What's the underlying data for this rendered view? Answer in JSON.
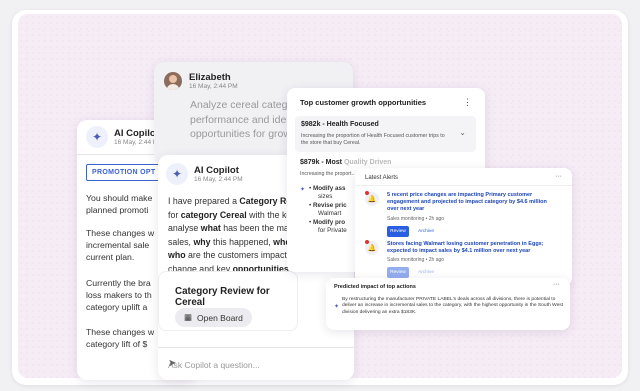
{
  "left_chat": {
    "name": "AI Copilot",
    "time": "16 May, 2:44 P",
    "promo_tag": "PROMOTION OPT",
    "paragraphs": [
      "You should make",
      "planned promoti",
      "These changes w",
      "incremental sale",
      "current plan.",
      "Currently the bra",
      "loss makers to th",
      "category uplift a",
      "These changes w",
      "category lift of $"
    ]
  },
  "elizabeth": {
    "name": "Elizabeth",
    "time": "16 May, 2:44 PM",
    "message_lines": [
      "Analyze cereal categor",
      "performance and identi",
      "opportunities for growt"
    ]
  },
  "copilot": {
    "name": "AI Copilot",
    "time": "16 May, 2:44 PM",
    "body": {
      "t1": "I have prepared a ",
      "b1": "Category Revi",
      "t2": "for ",
      "b2": "category Cereal",
      "t3": " with the key",
      "t4": "analyse ",
      "b3": "what",
      "t5": " has been the main",
      "t6": "sales, ",
      "b4": "why",
      "t7": " this happened, ",
      "b5": "where",
      "b6": "who",
      "t8": " are the customers impacting",
      "t9": "change and key ",
      "b7": "opportunities"
    },
    "review_title": "Category Review for Cereal",
    "open_board": "Open Board",
    "ask_placeholder": "Ask Copilot a question..."
  },
  "growth": {
    "title": "Top customer growth opportunities",
    "row1_title": "$982k - Health Focused",
    "row1_desc": "Increasing the proportion of Health Focused customer trips to the store that buy Cereal.",
    "row2_title_a": "$879k - Most ",
    "row2_title_b": "Quality Driven",
    "row2_desc": "Increasing the proport... to the store that buy...",
    "bullets": [
      "Modify ass",
      "sizes",
      "Revise pric",
      "Walmart",
      "Modify pro",
      "for Private"
    ]
  },
  "alerts": {
    "title": "Latest Alerts",
    "items": [
      {
        "text": "5 recent price changes are impacting Primary customer engagement and projected to impact category by $4.6 million over next year",
        "meta": "Sales monitoring • 2h ago",
        "review": "Review",
        "archive": "Archive"
      },
      {
        "text": "Stores facing Walmart losing customer penetration in Eggs; expected to impact sales by $4.1 million over next year",
        "meta": "Sales monitoring • 2h ago",
        "review": "Review",
        "archive": "Archive"
      }
    ]
  },
  "predicted": {
    "title": "Predicted impact of top actions",
    "desc": "By restructuring the manufacturer PRIVATE LABEL's deals across all divisions, there is potential to deliver an increase in incremental sales to the category, with the highest opportunity in the South West division delivering an extra $183K."
  },
  "colors": {
    "accent": "#2a5ee0",
    "link": "#1d46b8",
    "alert_dot": "#e0312f",
    "background": "#f6ecf6"
  }
}
